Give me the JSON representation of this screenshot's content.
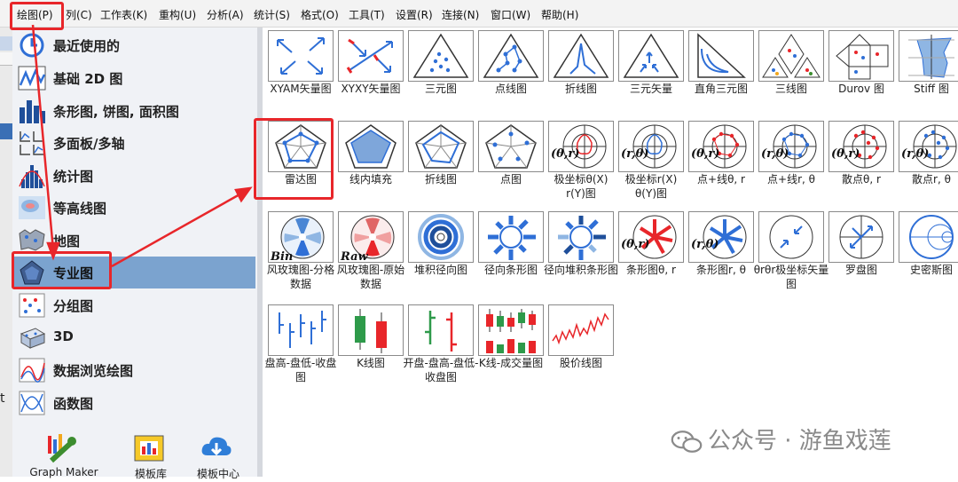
{
  "menu": [
    "绘图(P)",
    "列(C)",
    "工作表(K)",
    "重构(U)",
    "分析(A)",
    "统计(S)",
    "格式(O)",
    "工具(T)",
    "设置(R)",
    "连接(N)",
    "窗口(W)",
    "帮助(H)"
  ],
  "sidebar": {
    "items": [
      "最近使用的",
      "基础 2D 图",
      "条形图, 饼图, 面积图",
      "多面板/多轴",
      "统计图",
      "等高线图",
      "地图",
      "专业图",
      "分组图",
      "3D",
      "数据浏览绘图",
      "函数图"
    ],
    "selected": "专业图"
  },
  "bottom_tools": [
    "Graph Maker",
    "模板库",
    "模板中心"
  ],
  "gallery": {
    "row1": [
      "XYAM矢量图",
      "XYXY矢量图",
      "三元图",
      "点线图",
      "折线图",
      "三元矢量",
      "直角三元图",
      "三线图",
      "Durov 图",
      "Stiff 图"
    ],
    "row2": [
      "雷达图",
      "线内填充",
      "折线图",
      "点图",
      "极坐标θ(X) r(Y)图",
      "极坐标r(X) θ(Y)图",
      "点+线θ, r",
      "点+线r, θ",
      "散点θ, r",
      "散点r, θ"
    ],
    "row3": [
      "风玫瑰图-分格数据",
      "风玫瑰图-原始数据",
      "堆积径向图",
      "径向条形图",
      "径向堆积条形图",
      "条形图θ, r",
      "条形图r, θ",
      "θrθr极坐标矢量图",
      "罗盘图",
      "史密斯图"
    ],
    "row4": [
      "盘高-盘低-收盘图",
      "K线图",
      "开盘-盘高-盘低-收盘图",
      "K线-成交量图",
      "股价线图"
    ]
  },
  "thumb_text": {
    "theta_r": "(θ,r)",
    "r_theta": "(r,θ)",
    "bin": "Bin",
    "raw": "Raw"
  },
  "left_strip_text": "t",
  "watermark": "公众号 · 游鱼戏莲",
  "colors": {
    "highlight": "#e8262a",
    "selected": "#7ba3cf",
    "accent_blue": "#2f6fd6"
  }
}
